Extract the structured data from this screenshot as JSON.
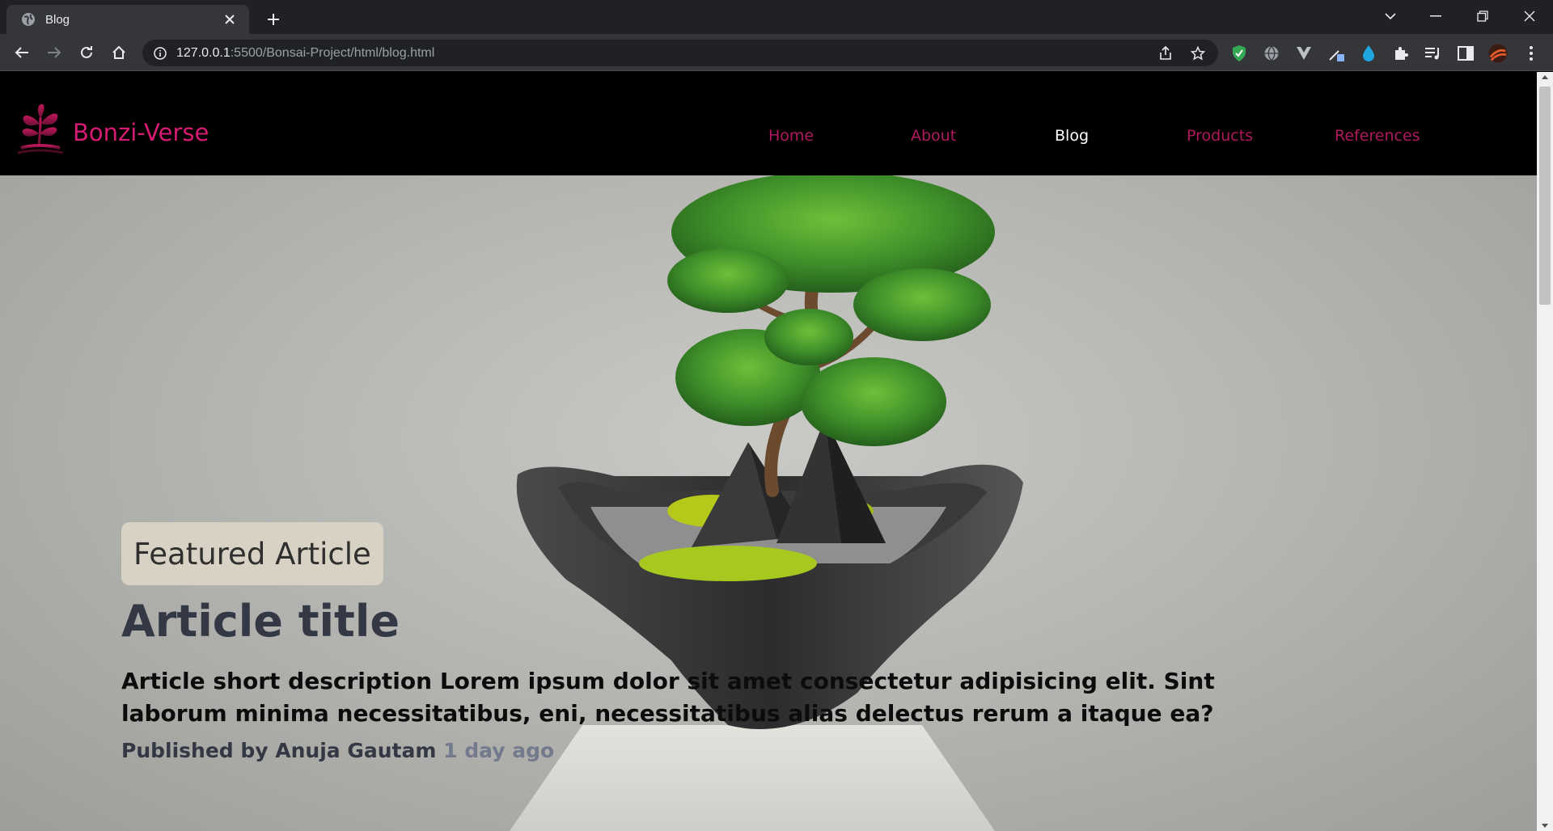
{
  "browser": {
    "tab_title": "Blog",
    "url_host": "127.0.0.1",
    "url_rest": ":5500/Bonsai-Project/html/blog.html"
  },
  "site": {
    "brand": "Bonzi-Verse",
    "brand_color": "#d81b72",
    "nav": [
      {
        "label": "Home",
        "active": false
      },
      {
        "label": "About",
        "active": false
      },
      {
        "label": "Blog",
        "active": true
      },
      {
        "label": "Products",
        "active": false
      },
      {
        "label": "References",
        "active": false
      }
    ]
  },
  "hero": {
    "badge": "Featured Article",
    "title": "Article title",
    "description": "Article short description Lorem ipsum dolor sit amet consectetur adipisicing elit. Sint laborum minima necessitatibus, eni, necessitatibus alias delectus rerum a itaque ea?",
    "published_by": "Published by Anuja Gautam",
    "time_ago": "1 day ago"
  }
}
